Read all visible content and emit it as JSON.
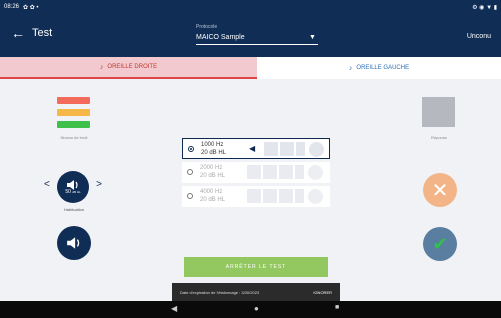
{
  "status_bar": {
    "time": "08:26",
    "left_icons": "✿ ✿ •",
    "right_icons": "⚙ ◉ ▼ ▮"
  },
  "app_bar": {
    "back_icon": "arrow-left-icon",
    "title": "Test",
    "protocol_label": "Protocole",
    "protocol_value": "MAICO Sample",
    "user": "Unconu"
  },
  "tabs": [
    {
      "label": "OREILLE DROITE",
      "active": true,
      "color": "#c0392b"
    },
    {
      "label": "OREILLE GAUCHE",
      "active": false,
      "color": "#2e6fb5"
    }
  ],
  "noise": {
    "label": "Niveau de bruit",
    "bars": [
      {
        "color": "#f26b5b"
      },
      {
        "color": "#f6b749"
      },
      {
        "color": "#3fc04a"
      }
    ]
  },
  "habituation": {
    "label": "Habituation",
    "value": "50",
    "unit": "dB HL"
  },
  "frequencies": [
    {
      "hz": "1000 Hz",
      "db": "20 dB HL",
      "selected": true
    },
    {
      "hz": "2000 Hz",
      "db": "20 dB HL",
      "selected": false
    },
    {
      "hz": "4000 Hz",
      "db": "20 dB HL",
      "selected": false
    }
  ],
  "response": {
    "label": "Réponse"
  },
  "stop_button": {
    "label": "ARRÊTER LE TEST"
  },
  "toast": {
    "message": "Date d'expiration de l'étalonnage : 3/30/2023",
    "action": "IGNORER"
  },
  "nav": {
    "back": "◀",
    "home": "●",
    "recent": "■"
  },
  "colors": {
    "primary": "#102d55",
    "right_tab": "#f1c9cf",
    "stop": "#93c760",
    "cancel": "#f3b588",
    "ok": "#5a7ea0"
  }
}
